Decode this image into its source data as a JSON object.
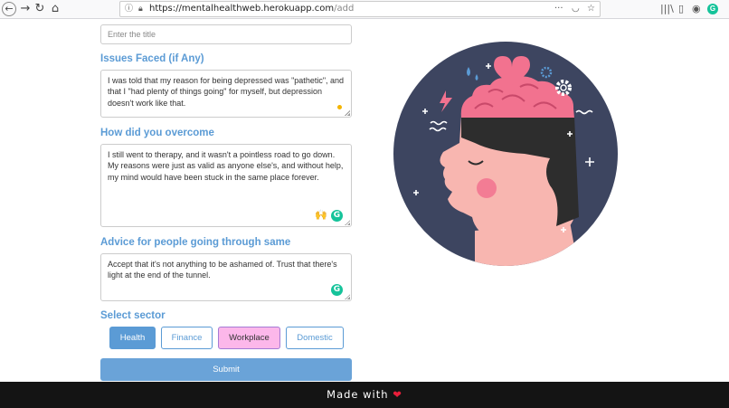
{
  "browser": {
    "back_icon": "back-arrow-icon",
    "url_domain": "https://mentalhealthweb.herokuapp.com",
    "url_path": "/add"
  },
  "form": {
    "title_placeholder": "Enter the title",
    "issues_label": "Issues Faced (if Any)",
    "issues_value": "I was told that my reason for being depressed was \"pathetic\", and that I \"had plenty of things going\" for myself, but depression doesn't work like that.",
    "overcome_label": "How did you overcome",
    "overcome_value": " I still went to therapy, and it wasn't a pointless road to go down. My reasons were just as valid as anyone else's, and without help, my mind would have been stuck in the same place forever.",
    "advice_label": "Advice for people going through same",
    "advice_value": "Accept that it's not anything to be ashamed of. Trust that there's light at the end of the tunnel.",
    "sector_label": "Select sector",
    "sectors": [
      {
        "label": "Health",
        "state": "selected"
      },
      {
        "label": "Finance",
        "state": "default"
      },
      {
        "label": "Workplace",
        "state": "highlighted"
      },
      {
        "label": "Domestic",
        "state": "default"
      }
    ],
    "submit_label": "Submit"
  },
  "footer": {
    "text": "Made with"
  },
  "colors": {
    "accent": "#5b9bd5",
    "pink": "#fcb7ea",
    "footer_bg": "#141414",
    "heart": "#e91e3a",
    "circle": "#3d4560",
    "brain": "#f2728f",
    "skin": "#f8b6b0",
    "hair": "#2d2d2d"
  }
}
